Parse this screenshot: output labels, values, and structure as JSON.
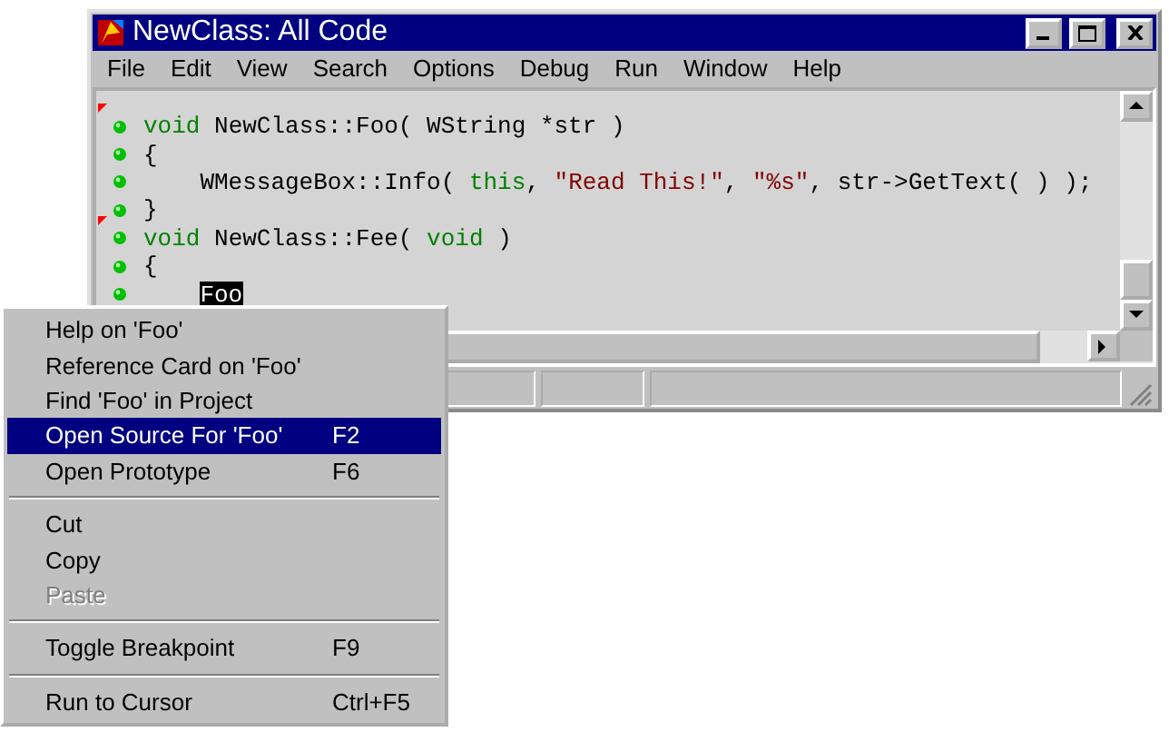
{
  "window": {
    "title": "NewClass: All Code"
  },
  "menu_bar": [
    "File",
    "Edit",
    "View",
    "Search",
    "Options",
    "Debug",
    "Run",
    "Window",
    "Help"
  ],
  "code_lines": [
    {
      "function_start": true,
      "tokens": [
        {
          "kind": "keyword",
          "text": "void"
        },
        {
          "kind": "plain",
          "text": " NewClass::Foo( WString *str )"
        }
      ]
    },
    {
      "function_start": false,
      "tokens": [
        {
          "kind": "plain",
          "text": "{"
        }
      ]
    },
    {
      "function_start": false,
      "indented": true,
      "tokens": [
        {
          "kind": "plain",
          "text": "WMessageBox::Info( "
        },
        {
          "kind": "keyword",
          "text": "this"
        },
        {
          "kind": "plain",
          "text": ", "
        },
        {
          "kind": "string",
          "text": "\"Read This!\""
        },
        {
          "kind": "plain",
          "text": ", "
        },
        {
          "kind": "string",
          "text": "\"%s\""
        },
        {
          "kind": "plain",
          "text": ", str->GetText( ) );"
        }
      ]
    },
    {
      "function_start": false,
      "tokens": [
        {
          "kind": "plain",
          "text": "}"
        }
      ]
    },
    {
      "function_start": true,
      "tokens": [
        {
          "kind": "keyword",
          "text": "void"
        },
        {
          "kind": "plain",
          "text": " NewClass::Fee( "
        },
        {
          "kind": "keyword",
          "text": "void"
        },
        {
          "kind": "plain",
          "text": " )"
        }
      ]
    },
    {
      "function_start": false,
      "tokens": [
        {
          "kind": "plain",
          "text": "{"
        }
      ]
    },
    {
      "function_start": false,
      "indented": true,
      "tokens": [
        {
          "kind": "selected",
          "text": "Foo"
        }
      ]
    }
  ],
  "context_menu": [
    {
      "kind": "item",
      "label": "Help on 'Foo'",
      "selected": false,
      "disabled": false
    },
    {
      "kind": "item",
      "label": "Reference Card on 'Foo'",
      "selected": false,
      "disabled": false
    },
    {
      "kind": "item",
      "label": "Find 'Foo' in Project",
      "selected": false,
      "disabled": false
    },
    {
      "kind": "item",
      "label": "Open Source For 'Foo'",
      "shortcut": "F2",
      "selected": true,
      "disabled": false
    },
    {
      "kind": "item",
      "label": "Open Prototype",
      "shortcut": "F6",
      "selected": false,
      "disabled": false
    },
    {
      "kind": "separator"
    },
    {
      "kind": "item",
      "label": "Cut",
      "selected": false,
      "disabled": false
    },
    {
      "kind": "item",
      "label": "Copy",
      "selected": false,
      "disabled": false
    },
    {
      "kind": "item",
      "label": "Paste",
      "selected": false,
      "disabled": true
    },
    {
      "kind": "separator"
    },
    {
      "kind": "item",
      "label": "Toggle Breakpoint",
      "shortcut": "F9",
      "selected": false,
      "disabled": false
    },
    {
      "kind": "separator"
    },
    {
      "kind": "item",
      "label": "Run to Cursor",
      "shortcut": "Ctrl+F5",
      "selected": false,
      "disabled": false
    }
  ]
}
